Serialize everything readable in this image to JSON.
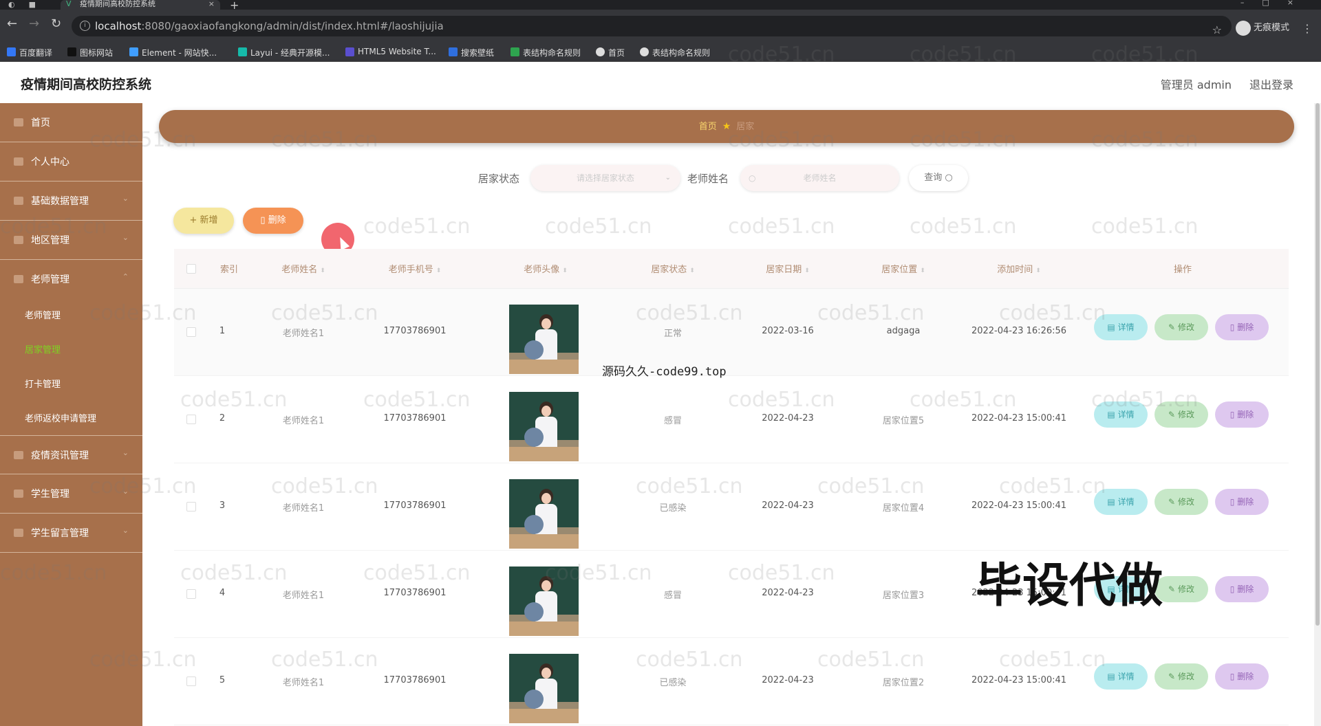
{
  "browser": {
    "tab_title": "疫情期间高校防控系统",
    "url_host": "localhost",
    "url_rest": ":8080/gaoxiaofangkong/admin/dist/index.html#/laoshijujia",
    "incognito_label": "无痕模式",
    "bookmarks": [
      {
        "label": "百度翻译",
        "color": "#3478f6"
      },
      {
        "label": "图标网站",
        "color": "#111111"
      },
      {
        "label": "Element - 网站快...",
        "color": "#409eff"
      },
      {
        "label": "Layui - 经典开源模...",
        "color": "#16baaa"
      },
      {
        "label": "HTML5 Website T...",
        "color": "#5a4fcf"
      },
      {
        "label": "搜索壁纸",
        "color": "#2f6fde"
      },
      {
        "label": "表结构命名规则",
        "color": "#2ea44f"
      },
      {
        "label": "首页",
        "color": "#dddddd"
      },
      {
        "label": "表结构命名规则",
        "color": "#dddddd"
      }
    ]
  },
  "header": {
    "title": "疫情期间高校防控系统",
    "admin_label": "管理员 admin",
    "logout_label": "退出登录"
  },
  "sidebar": {
    "items": [
      {
        "label": "首页"
      },
      {
        "label": "个人中心"
      },
      {
        "label": "基础数据管理"
      },
      {
        "label": "地区管理"
      },
      {
        "label": "老师管理"
      }
    ],
    "subitems": [
      {
        "label": "老师管理",
        "active": false
      },
      {
        "label": "居家管理",
        "active": true
      },
      {
        "label": "打卡管理",
        "active": false
      },
      {
        "label": "老师返校申请管理",
        "active": false
      }
    ],
    "items_after": [
      {
        "label": "疫情资讯管理"
      },
      {
        "label": "学生管理"
      },
      {
        "label": "学生留言管理"
      }
    ],
    "active_color": "#7ed321"
  },
  "breadcrumb": {
    "home": "首页",
    "current": "居家"
  },
  "search": {
    "status_label": "居家状态",
    "status_placeholder": "请选择居家状态",
    "name_label": "老师姓名",
    "name_placeholder": "老师姓名",
    "query_label": "查询"
  },
  "actions": {
    "add_label": "+ 新增",
    "delete_label": "删除"
  },
  "table": {
    "headers": [
      "索引",
      "老师姓名",
      "老师手机号",
      "老师头像",
      "居家状态",
      "居家日期",
      "居家位置",
      "添加时间",
      "操作"
    ],
    "rows": [
      {
        "index": "1",
        "name": "老师姓名1",
        "phone": "17703786901",
        "status": "正常",
        "date": "2022-03-16",
        "location": "adgaga",
        "added": "2022-04-23 16:26:56"
      },
      {
        "index": "2",
        "name": "老师姓名1",
        "phone": "17703786901",
        "status": "感冒",
        "date": "2022-04-23",
        "location": "居家位置5",
        "added": "2022-04-23 15:00:41"
      },
      {
        "index": "3",
        "name": "老师姓名1",
        "phone": "17703786901",
        "status": "已感染",
        "date": "2022-04-23",
        "location": "居家位置4",
        "added": "2022-04-23 15:00:41"
      },
      {
        "index": "4",
        "name": "老师姓名1",
        "phone": "17703786901",
        "status": "感冒",
        "date": "2022-04-23",
        "location": "居家位置3",
        "added": "2022-04-23 15:00:41"
      },
      {
        "index": "5",
        "name": "老师姓名1",
        "phone": "17703786901",
        "status": "已感染",
        "date": "2022-04-23",
        "location": "居家位置2",
        "added": "2022-04-23 15:00:41"
      }
    ],
    "row_buttons": {
      "detail": "详情",
      "edit": "修改",
      "delete": "删除"
    }
  },
  "overlays": {
    "watermark": "code51.cn",
    "source_text": "源码久久-code99.top",
    "promo_text": "毕设代做"
  },
  "colors": {
    "sidebar": "#a7704b",
    "breadcrumb": "#a7704b",
    "add_button": "#f5e79e",
    "delete_button": "#f59355"
  }
}
